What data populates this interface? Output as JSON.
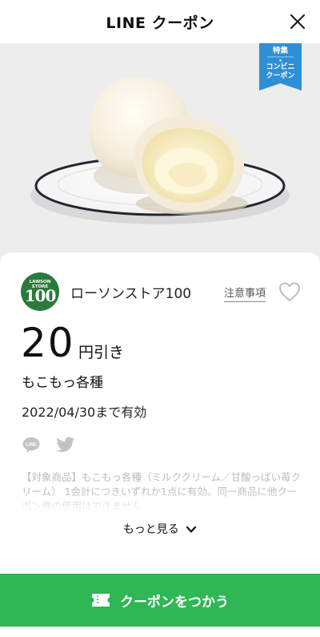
{
  "header": {
    "title": "LINE クーポン"
  },
  "badge": {
    "line1": "特集",
    "line2": "コンビニ",
    "line3": "クーポン",
    "color": "#2e8fd6"
  },
  "coupon": {
    "logo_top": "LAWSON STORE",
    "logo_number": "100",
    "store_name": "ローソンストア100",
    "notes_label": "注意事項",
    "discount_amount": "20",
    "discount_unit": "円引き",
    "product": "もこもっ各種",
    "validity": "2022/04/30まで有効",
    "description": "【対象商品】もこもっ各種（ミルククリーム／甘酸っぱい苺クリーム） 1会計につきいずれか1点に有効。同一商品に他クーポン券の使用はできません",
    "more_label": "もっと見る"
  },
  "share": {
    "line_icon": "line-icon",
    "twitter_icon": "twitter-icon"
  },
  "action": {
    "use_label": "クーポンをつかう",
    "color": "#2fb655"
  }
}
